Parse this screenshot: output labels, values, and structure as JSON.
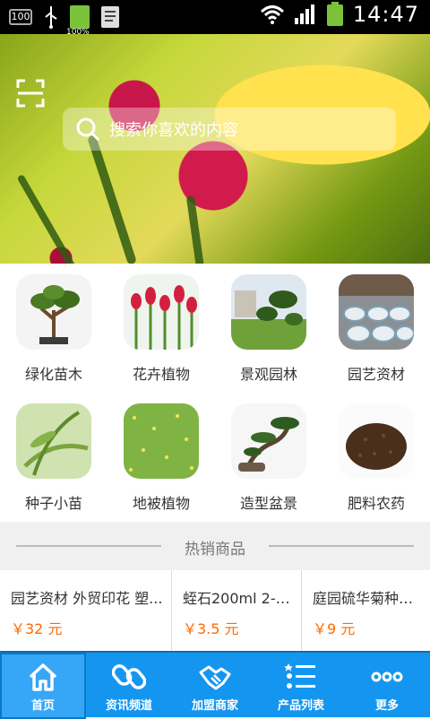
{
  "status_bar": {
    "time": "14:47",
    "battery_text": "100%",
    "badge_text": "100"
  },
  "search": {
    "placeholder": "搜索你喜欢的内容"
  },
  "banner": {
    "slides": 5,
    "active_slide": 4
  },
  "categories": [
    {
      "label": "绿化苗木",
      "icon": "bonsai-tree-image"
    },
    {
      "label": "花卉植物",
      "icon": "tulips-image"
    },
    {
      "label": "景观园林",
      "icon": "landscape-trees-image"
    },
    {
      "label": "园艺资材",
      "icon": "garden-pots-image"
    },
    {
      "label": "种子小苗",
      "icon": "seedling-image"
    },
    {
      "label": "地被植物",
      "icon": "ground-cover-image"
    },
    {
      "label": "造型盆景",
      "icon": "bonsai-image"
    },
    {
      "label": "肥料农药",
      "icon": "fertilizer-soil-image"
    }
  ],
  "hot_section": {
    "title": "热销商品"
  },
  "products": [
    {
      "name": "园艺资材 外贸印花 塑...",
      "price": "￥32 元"
    },
    {
      "name": "蛭石200ml 2-3...",
      "price": "￥3.5 元"
    },
    {
      "name": "庭园硫华菊种子...",
      "price": "￥9 元"
    }
  ],
  "tabs": [
    {
      "label": "首页",
      "icon": "home-icon"
    },
    {
      "label": "资讯频道",
      "icon": "link-icon"
    },
    {
      "label": "加盟商家",
      "icon": "handshake-icon"
    },
    {
      "label": "产品列表",
      "icon": "list-icon"
    },
    {
      "label": "更多",
      "icon": "more-icon"
    }
  ],
  "colors": {
    "tabbar": "#1496f0",
    "price": "#ff6a00"
  }
}
